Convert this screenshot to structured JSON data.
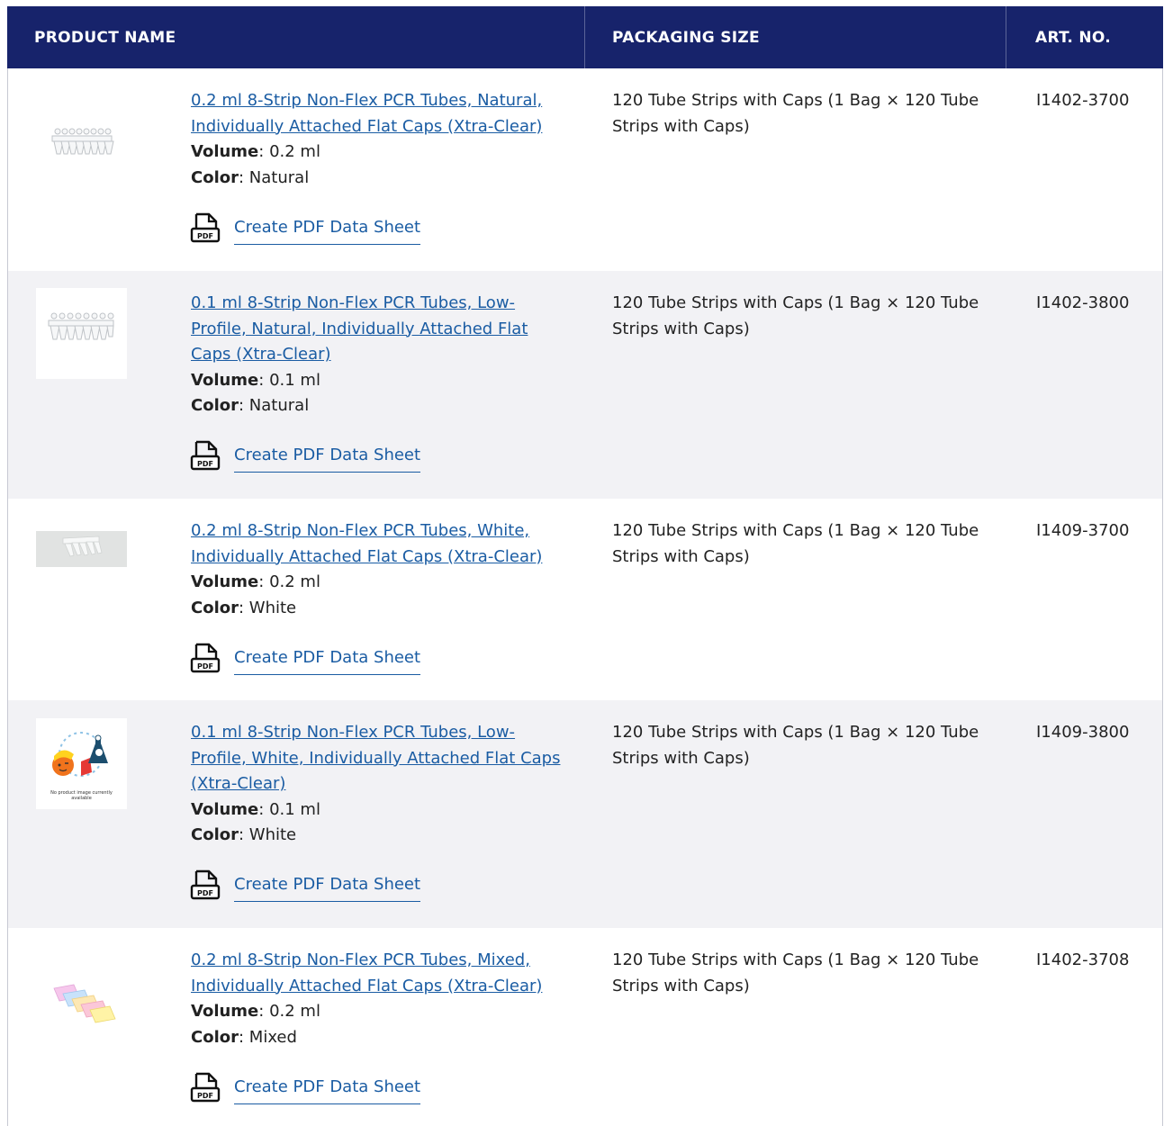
{
  "table": {
    "headers": {
      "product_name": "PRODUCT NAME",
      "packaging_size": "PACKAGING SIZE",
      "art_no": "ART. NO."
    },
    "pdf_label": "Create PDF Data Sheet",
    "volume_label": "Volume",
    "color_label": "Color",
    "rows": [
      {
        "name": "0.2 ml 8-Strip Non-Flex PCR Tubes, Natural, Individually Attached Flat Caps (Xtra-Clear)",
        "volume": "0.2 ml",
        "color": "Natural",
        "packaging": "120 Tube Strips with Caps (1 Bag × 120 Tube Strips with Caps)",
        "art_no": "I1402-3700"
      },
      {
        "name": "0.1 ml 8-Strip Non-Flex PCR Tubes, Low-Profile, Natural, Individually Attached Flat Caps (Xtra-Clear)",
        "volume": "0.1 ml",
        "color": "Natural",
        "packaging": "120 Tube Strips with Caps (1 Bag × 120 Tube Strips with Caps)",
        "art_no": "I1402-3800"
      },
      {
        "name": "0.2 ml 8-Strip Non-Flex PCR Tubes, White, Individually Attached Flat Caps (Xtra-Clear)",
        "volume": "0.2 ml",
        "color": "White",
        "packaging": "120 Tube Strips with Caps (1 Bag × 120 Tube Strips with Caps)",
        "art_no": "I1409-3700"
      },
      {
        "name": "0.1 ml 8-Strip Non-Flex PCR Tubes, Low-Profile, White, Individually Attached Flat Caps (Xtra-Clear)",
        "volume": "0.1 ml",
        "color": "White",
        "packaging": "120 Tube Strips with Caps (1 Bag × 120 Tube Strips with Caps)",
        "art_no": "I1409-3800",
        "placeholder_text": "No product image currently available"
      },
      {
        "name": "0.2 ml 8-Strip Non-Flex PCR Tubes, Mixed, Individually Attached Flat Caps (Xtra-Clear)",
        "volume": "0.2 ml",
        "color": "Mixed",
        "packaging": "120 Tube Strips with Caps (1 Bag × 120 Tube Strips with Caps)",
        "art_no": "I1402-3708"
      }
    ]
  },
  "colors": {
    "header_bg": "#17236b",
    "link": "#1a5ca3",
    "alt_row": "#f2f2f5"
  },
  "icons": {
    "pdf": "pdf-document-icon"
  }
}
